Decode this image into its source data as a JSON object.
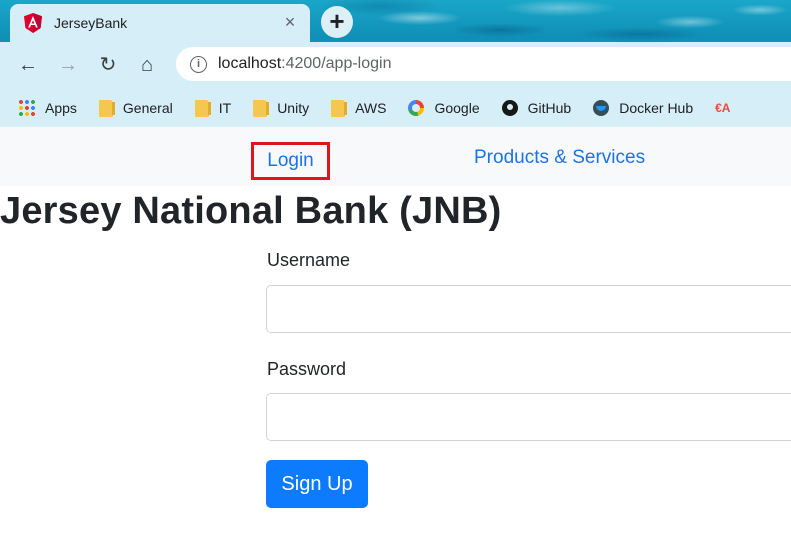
{
  "browser": {
    "tab": {
      "title": "JerseyBank",
      "close_glyph": "×",
      "favicon": "angular-icon"
    },
    "new_tab_glyph": "+",
    "nav": {
      "back_glyph": "←",
      "forward_glyph": "→",
      "reload_glyph": "↻",
      "home_glyph": "⌂"
    },
    "omnibox": {
      "info_glyph": "i",
      "host": "localhost",
      "path": ":4200/app-login"
    },
    "bookmarks": [
      {
        "label": "Apps",
        "icon": "apps-icon"
      },
      {
        "label": "General",
        "icon": "folder-icon"
      },
      {
        "label": "IT",
        "icon": "folder-icon"
      },
      {
        "label": "Unity",
        "icon": "folder-icon"
      },
      {
        "label": "AWS",
        "icon": "folder-icon"
      },
      {
        "label": "Google",
        "icon": "google-icon"
      },
      {
        "label": "GitHub",
        "icon": "github-icon"
      },
      {
        "label": "Docker Hub",
        "icon": "docker-icon"
      }
    ]
  },
  "navbar": {
    "login": "Login",
    "products": "Products & Services"
  },
  "page": {
    "title": "Jersey National Bank (JNB)",
    "username_label": "Username",
    "username_value": "",
    "password_label": "Password",
    "password_value": "",
    "signup_label": "Sign Up"
  },
  "colors": {
    "link": "#1a73e8",
    "highlight_border": "#e0151b",
    "primary_button": "#0d7bfd"
  }
}
